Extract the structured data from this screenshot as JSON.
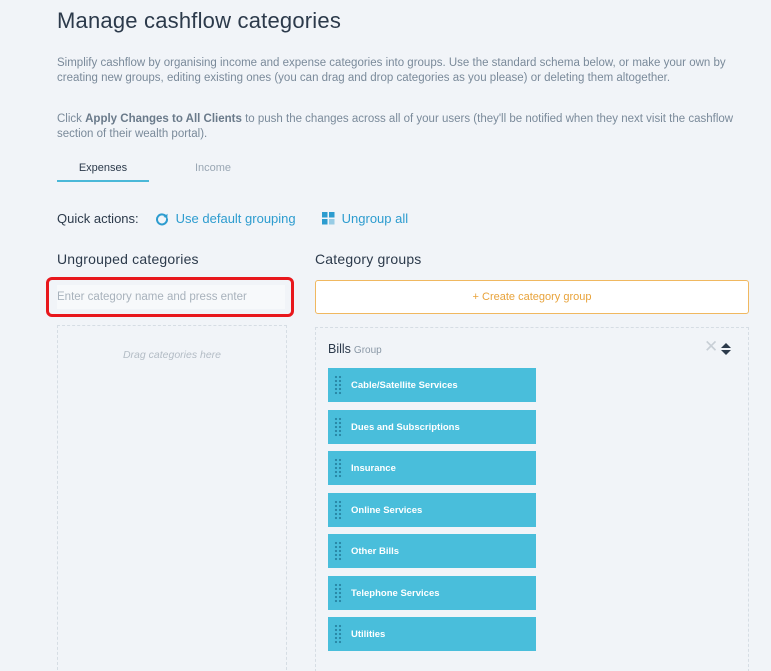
{
  "page": {
    "title": "Manage cashflow categories",
    "description_1": "Simplify cashflow by organising income and expense categories into groups. Use the standard schema below, or make your own by creating new groups, editing existing ones (you can drag and drop categories as you please) or deleting them altogether.",
    "description_2_prefix": "Click ",
    "description_2_bold": "Apply Changes to All Clients",
    "description_2_suffix": " to push the changes across all of your users (they'll be notified when they next visit the cashflow section of their wealth portal)."
  },
  "tabs": [
    {
      "label": "Expenses",
      "active": true
    },
    {
      "label": "Income",
      "active": false
    }
  ],
  "quick_actions": {
    "label": "Quick actions:",
    "default_grouping": {
      "label": "Use default grouping",
      "icon": "refresh-icon"
    },
    "ungroup_all": {
      "label": "Ungroup all",
      "icon": "grid-icon"
    }
  },
  "ungrouped": {
    "title": "Ungrouped categories",
    "input_placeholder": "Enter category name and press enter",
    "input_value": "",
    "dropzone_text": "Drag categories here"
  },
  "groups": {
    "title": "Category groups",
    "create_label": "+ Create category group",
    "items": [
      {
        "name": "Bills",
        "sub": "Group",
        "categories": [
          "Cable/Satellite Services",
          "Dues and Subscriptions",
          "Insurance",
          "Online Services",
          "Other Bills",
          "Telephone Services",
          "Utilities"
        ]
      }
    ]
  },
  "colors": {
    "accent": "#2d9ccf",
    "category_bg": "#49bedb",
    "create_border": "#f0b860",
    "highlight": "#e8171c"
  }
}
